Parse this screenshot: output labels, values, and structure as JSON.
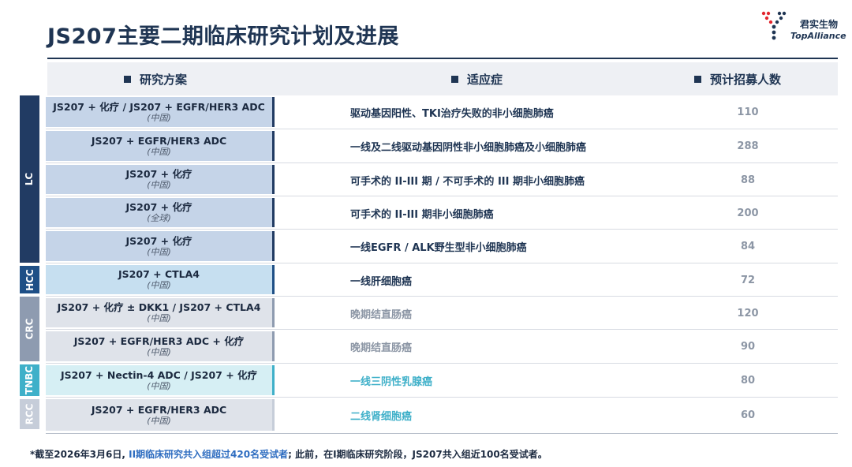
{
  "title": "JS207主要二期临床研究计划及进展",
  "logo": {
    "cn": "君实生物",
    "en": "TopAlliance"
  },
  "headers": {
    "plan": "研究方案",
    "indication": "适应症",
    "enrollment": "预计招募人数"
  },
  "categories": [
    {
      "label": "LC",
      "color": "#213b63"
    },
    {
      "label": "HCC",
      "color": "#1e4f86"
    },
    {
      "label": "CRC",
      "color": "#8e9bb0"
    },
    {
      "label": "TNBC",
      "color": "#3fb0c9"
    },
    {
      "label": "RCC",
      "color": "#c6cdd9"
    }
  ],
  "rows": [
    {
      "plan": "JS207 + 化疗 / JS207 + EGFR/HER3 ADC",
      "region": "(中国)",
      "indication": "驱动基因阳性、TKI治疗失败的非小细胞肺癌",
      "enrollment": "110"
    },
    {
      "plan": "JS207 + EGFR/HER3 ADC",
      "region": "(中国)",
      "indication": "一线及二线驱动基因阴性非小细胞肺癌及小细胞肺癌",
      "enrollment": "288"
    },
    {
      "plan": "JS207 + 化疗",
      "region": "(中国)",
      "indication": "可手术的 II-III 期 / 不可手术的 III 期非小细胞肺癌",
      "enrollment": "88"
    },
    {
      "plan": "JS207 + 化疗",
      "region": "(全球)",
      "indication": "可手术的 II-III 期非小细胞肺癌",
      "enrollment": "200"
    },
    {
      "plan": "JS207 + 化疗",
      "region": "(中国)",
      "indication": "一线EGFR / ALK野生型非小细胞肺癌",
      "enrollment": "84"
    },
    {
      "plan": "JS207 + CTLA4",
      "region": "(中国)",
      "indication": "一线肝细胞癌",
      "enrollment": "72"
    },
    {
      "plan": "JS207 + 化疗 ± DKK1 / JS207 + CTLA4",
      "region": "(中国)",
      "indication": "晚期结直肠癌",
      "enrollment": "120"
    },
    {
      "plan": "JS207 + EGFR/HER3 ADC + 化疗",
      "region": "(中国)",
      "indication": "晚期结直肠癌",
      "enrollment": "90"
    },
    {
      "plan": "JS207 + Nectin-4 ADC / JS207 + 化疗",
      "region": "(中国)",
      "indication": "一线三阴性乳腺癌",
      "enrollment": "80"
    },
    {
      "plan": "JS207 + EGFR/HER3 ADC",
      "region": "(中国)",
      "indication": "二线肾细胞癌",
      "enrollment": "60"
    }
  ],
  "footnote": {
    "part1": "*截至2026年3月6日, ",
    "highlight": "II期临床研究共入组超过420名受试者",
    "part2": "; 此前，在I期临床研究阶段，JS207共入组近100名受试者。"
  }
}
